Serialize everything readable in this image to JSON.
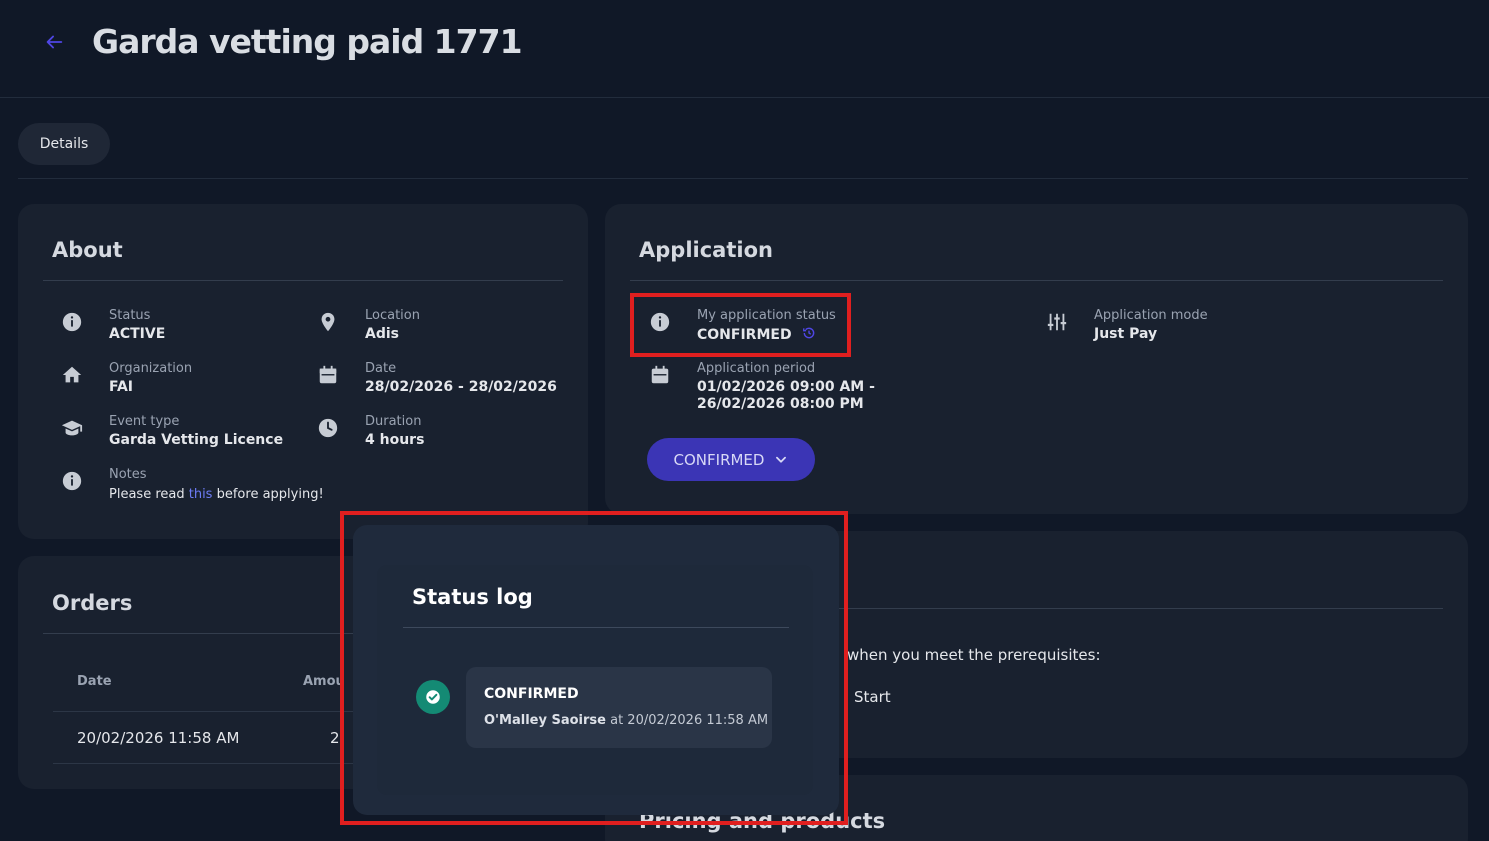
{
  "header": {
    "title": "Garda vetting paid 1771"
  },
  "tabs": [
    {
      "label": "Details"
    }
  ],
  "about": {
    "title": "About",
    "status": {
      "label": "Status",
      "value": "ACTIVE"
    },
    "location": {
      "label": "Location",
      "value": "Adis"
    },
    "organization": {
      "label": "Organization",
      "value": "FAI"
    },
    "date": {
      "label": "Date",
      "value": "28/02/2026 - 28/02/2026"
    },
    "event_type": {
      "label": "Event type",
      "value": "Garda Vetting Licence"
    },
    "duration": {
      "label": "Duration",
      "value": "4 hours"
    },
    "notes": {
      "label": "Notes",
      "prefix": "Please read ",
      "link": "this",
      "suffix": " before applying!"
    }
  },
  "application": {
    "title": "Application",
    "my_status": {
      "label": "My application status",
      "value": "CONFIRMED"
    },
    "mode": {
      "label": "Application mode",
      "value": "Just Pay"
    },
    "period": {
      "label": "Application period",
      "line1": "01/02/2026 09:00 AM -",
      "line2": "26/02/2026 08:00 PM"
    },
    "status_button": "CONFIRMED"
  },
  "orders": {
    "title": "Orders",
    "columns": [
      "Date",
      "Amou"
    ],
    "rows": [
      {
        "date": "20/02/2026 11:58 AM",
        "amount": "2"
      }
    ]
  },
  "prerequisites": {
    "text_fragment": "when you meet the prerequisites:",
    "item_fragment": "Start"
  },
  "pricing": {
    "title_fragment": "Pricing and products"
  },
  "status_log": {
    "title": "Status log",
    "entries": [
      {
        "status": "CONFIRMED",
        "user": "O'Malley Saoirse",
        "connector": " at ",
        "timestamp": "20/02/2026 11:58 AM"
      }
    ]
  },
  "colors": {
    "accent": "#3b35b5",
    "highlight": "#e01f1f",
    "success": "#148a74",
    "background": "#101827"
  }
}
